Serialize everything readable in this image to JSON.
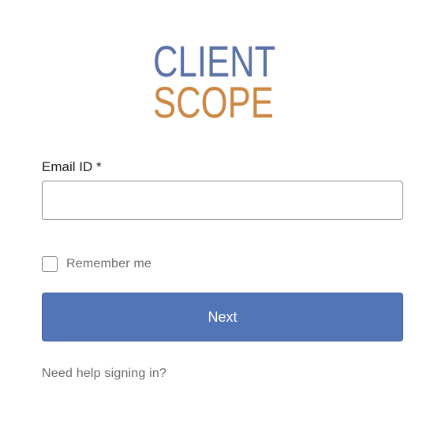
{
  "logo": {
    "line1": "CLIENT",
    "line2": "SCOPE",
    "line1_color": "#5a72a5",
    "line2_color": "#cc8843"
  },
  "form": {
    "email_label": "Email ID *",
    "email_value": "",
    "remember_label": "Remember me",
    "remember_checked": false,
    "next_label": "Next",
    "help_link": "Need help signing in?"
  },
  "colors": {
    "primary_button": "#5275b8",
    "text_muted": "#6b6b6b"
  }
}
